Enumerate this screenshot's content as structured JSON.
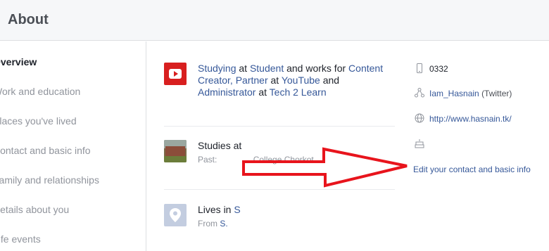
{
  "header": {
    "title": "About"
  },
  "sidebar": {
    "items": [
      {
        "label": "Overview",
        "active": true
      },
      {
        "label": "Work and education"
      },
      {
        "label": "Places you've lived"
      },
      {
        "label": "Contact and basic info"
      },
      {
        "label": "Family and relationships"
      },
      {
        "label": "Details about you"
      },
      {
        "label": "Life events"
      }
    ]
  },
  "main": {
    "work": {
      "icon": "youtube-icon",
      "w1": "Studying",
      "t1": " at ",
      "w2": "Student",
      "t2": " and works for ",
      "w3": "Content Creator, Partner",
      "t3": " at ",
      "w4": "YouTube",
      "t4": " and ",
      "w5": "Administrator",
      "t5": " at ",
      "w6": "Tech 2 Learn"
    },
    "education": {
      "icon": "school-photo",
      "title_prefix": "Studies at",
      "sub_prefix": "Past:",
      "sub_name": "College Chorkot"
    },
    "lives": {
      "icon": "location-pin-icon",
      "title_prefix": "Lives in",
      "title_place": "S",
      "sub_prefix": "From",
      "sub_place": "S."
    }
  },
  "contact": {
    "phone": {
      "icon": "mobile-phone-icon",
      "value": "0332"
    },
    "twitter": {
      "icon": "share-network-icon",
      "handle": "Iam_Hasnain",
      "note": "(Twitter)"
    },
    "website": {
      "icon": "globe-icon",
      "url": "http://www.hasnain.tk/"
    },
    "birthday": {
      "icon": "birthday-cake-icon"
    },
    "edit_label": "Edit your contact and basic info"
  },
  "annotation": {
    "icon": "red-arrow-icon",
    "color": "#e8141c"
  }
}
